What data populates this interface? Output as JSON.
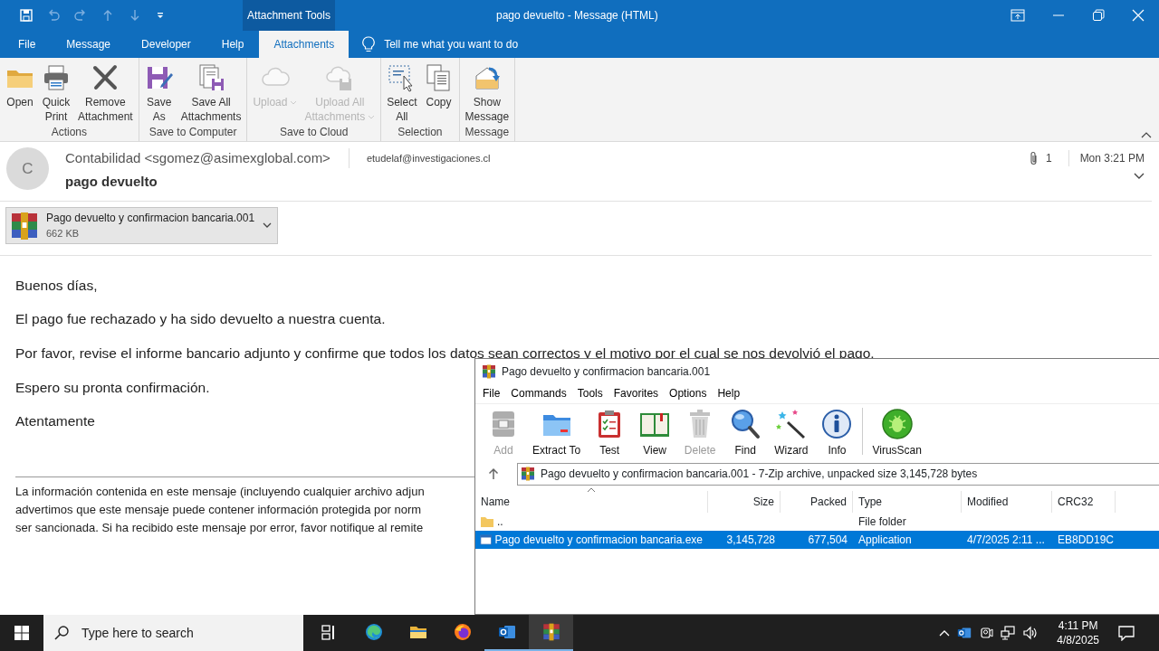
{
  "window": {
    "title": "pago devuelto  -  Message (HTML)",
    "context_tab_group": "Attachment Tools"
  },
  "quick_access": [
    {
      "kind": "save",
      "disabled": false
    },
    {
      "kind": "undo",
      "disabled": true
    },
    {
      "kind": "redo",
      "disabled": true
    },
    {
      "kind": "up",
      "disabled": true
    },
    {
      "kind": "down",
      "disabled": true
    },
    {
      "kind": "customize",
      "disabled": false
    }
  ],
  "menu_tabs": [
    {
      "label": "File",
      "selected": false
    },
    {
      "label": "Message",
      "selected": false
    },
    {
      "label": "Developer",
      "selected": false
    },
    {
      "label": "Help",
      "selected": false
    },
    {
      "label": "Attachments",
      "selected": true
    }
  ],
  "tell_me": "Tell me what you want to do",
  "ribbon_groups": [
    {
      "label": "Actions",
      "buttons": [
        {
          "kind": "open",
          "label": "Open",
          "disabled": false
        },
        {
          "kind": "quick-print",
          "label": "Quick\nPrint",
          "disabled": false
        },
        {
          "kind": "remove-attachment",
          "label": "Remove\nAttachment",
          "disabled": false
        }
      ]
    },
    {
      "label": "Save to Computer",
      "buttons": [
        {
          "kind": "save-as",
          "label": "Save\nAs",
          "disabled": false
        },
        {
          "kind": "save-all",
          "label": "Save All\nAttachments",
          "disabled": false
        }
      ]
    },
    {
      "label": "Save to Cloud",
      "buttons": [
        {
          "kind": "upload",
          "label": "Upload",
          "disabled": true,
          "dropdown": true
        },
        {
          "kind": "upload-all",
          "label": "Upload All\nAttachments",
          "disabled": true,
          "dropdown": true
        }
      ]
    },
    {
      "label": "Selection",
      "buttons": [
        {
          "kind": "select-all",
          "label": "Select\nAll",
          "disabled": false
        },
        {
          "kind": "copy",
          "label": "Copy",
          "disabled": false
        }
      ]
    },
    {
      "label": "Message",
      "buttons": [
        {
          "kind": "show-message",
          "label": "Show\nMessage",
          "disabled": false
        }
      ]
    }
  ],
  "message": {
    "avatar_letter": "C",
    "sender": "Contabilidad <sgomez@asimexglobal.com>",
    "recipient": "etudelaf@investigaciones.cl",
    "attachment_count": "1",
    "time": "Mon 3:21 PM",
    "subject": "pago devuelto"
  },
  "attachment": {
    "name": "Pago devuelto y confirmacion bancaria.001",
    "size": "662 KB"
  },
  "body": [
    "Buenos días,",
    "El pago fue rechazado y ha sido devuelto a nuestra cuenta.",
    "Por favor, revise el informe bancario adjunto y confirme que todos los datos sean correctos y el motivo por el cual se nos devolvió el pago.",
    "Espero su pronta confirmación.",
    "Atentamente"
  ],
  "disclaimer": [
    "La información contenida en este mensaje (incluyendo cualquier archivo adjun",
    "advertimos que este mensaje puede contener información protegida por norm",
    "ser sancionada. Si ha recibido este mensaje por error, favor notifique al remite"
  ],
  "archive_window": {
    "title": "Pago devuelto y confirmacion bancaria.001",
    "menu": [
      "File",
      "Commands",
      "Tools",
      "Favorites",
      "Options",
      "Help"
    ],
    "toolbar": [
      {
        "kind": "add",
        "label": "Add",
        "disabled": true
      },
      {
        "kind": "extract",
        "label": "Extract To",
        "disabled": false
      },
      {
        "kind": "test",
        "label": "Test",
        "disabled": false
      },
      {
        "kind": "view",
        "label": "View",
        "disabled": false
      },
      {
        "kind": "delete",
        "label": "Delete",
        "disabled": true
      },
      {
        "kind": "find",
        "label": "Find",
        "disabled": false
      },
      {
        "kind": "wizard",
        "label": "Wizard",
        "disabled": false
      },
      {
        "kind": "info",
        "label": "Info",
        "disabled": false
      },
      {
        "kind": "virusscan",
        "label": "VirusScan",
        "disabled": false
      }
    ],
    "address": "Pago devuelto y confirmacion bancaria.001 - 7-Zip archive, unpacked size 3,145,728 bytes",
    "columns": [
      {
        "label": "Name",
        "sorted": true
      },
      {
        "label": "Size",
        "sorted": false
      },
      {
        "label": "Packed",
        "sorted": false
      },
      {
        "label": "Type",
        "sorted": false
      },
      {
        "label": "Modified",
        "sorted": false
      },
      {
        "label": "CRC32",
        "sorted": false
      }
    ],
    "rows": [
      {
        "kind": "folder",
        "name": "..",
        "type": "File folder",
        "selected": false
      },
      {
        "kind": "exe",
        "name": "Pago devuelto y confirmacion bancaria.exe",
        "size": "3,145,728",
        "packed": "677,504",
        "type": "Application",
        "modified": "4/7/2025 2:11 ...",
        "crc32": "EB8DD19C",
        "selected": true
      }
    ]
  },
  "taskbar": {
    "search_placeholder": "Type here to search",
    "apps": [
      {
        "kind": "task-view",
        "running": false,
        "selected": false
      },
      {
        "kind": "edge",
        "running": false,
        "selected": false
      },
      {
        "kind": "explorer",
        "running": false,
        "selected": false
      },
      {
        "kind": "firefox",
        "running": false,
        "selected": false
      },
      {
        "kind": "outlook",
        "running": true,
        "selected": false
      },
      {
        "kind": "winrar",
        "running": true,
        "selected": true
      }
    ],
    "time": "4:11 PM",
    "date": "4/8/2025"
  }
}
